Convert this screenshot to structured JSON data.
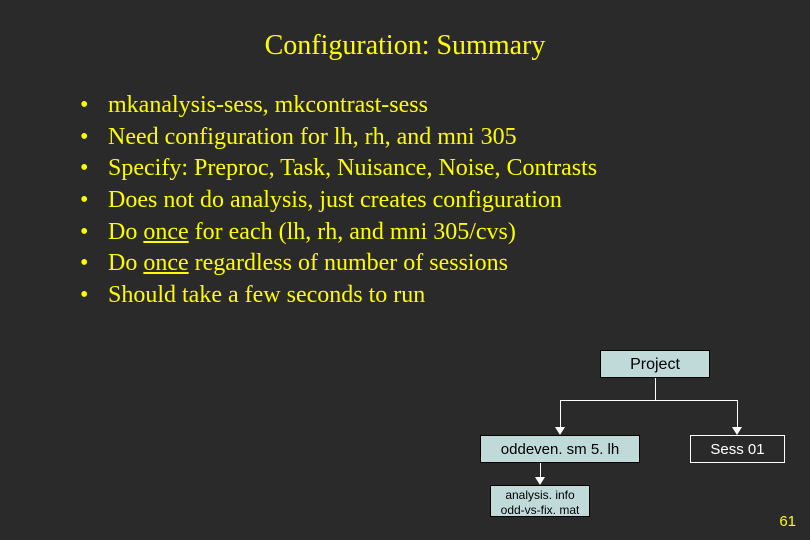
{
  "title": "Configuration: Summary",
  "bullets": [
    {
      "pre": "mkanalysis-sess, mkcontrast-sess",
      "u": "",
      "post": ""
    },
    {
      "pre": "Need configuration for lh, rh, and mni 305",
      "u": "",
      "post": ""
    },
    {
      "pre": "Specify: Preproc, Task, Nuisance, Noise, Contrasts",
      "u": "",
      "post": ""
    },
    {
      "pre": "Does not do analysis, just creates configuration",
      "u": "",
      "post": ""
    },
    {
      "pre": "Do ",
      "u": "once",
      "post": " for each (lh, rh, and mni 305/cvs)"
    },
    {
      "pre": "Do ",
      "u": "once",
      "post": " regardless of number of sessions"
    },
    {
      "pre": "Should take a few seconds to run",
      "u": "",
      "post": ""
    }
  ],
  "diagram": {
    "project": "Project",
    "oddeven": "oddeven. sm 5. lh",
    "sess": "Sess 01",
    "files_line1": "analysis. info",
    "files_line2": "odd-vs-fix. mat"
  },
  "slide_number": "61",
  "bullet_char": "•"
}
